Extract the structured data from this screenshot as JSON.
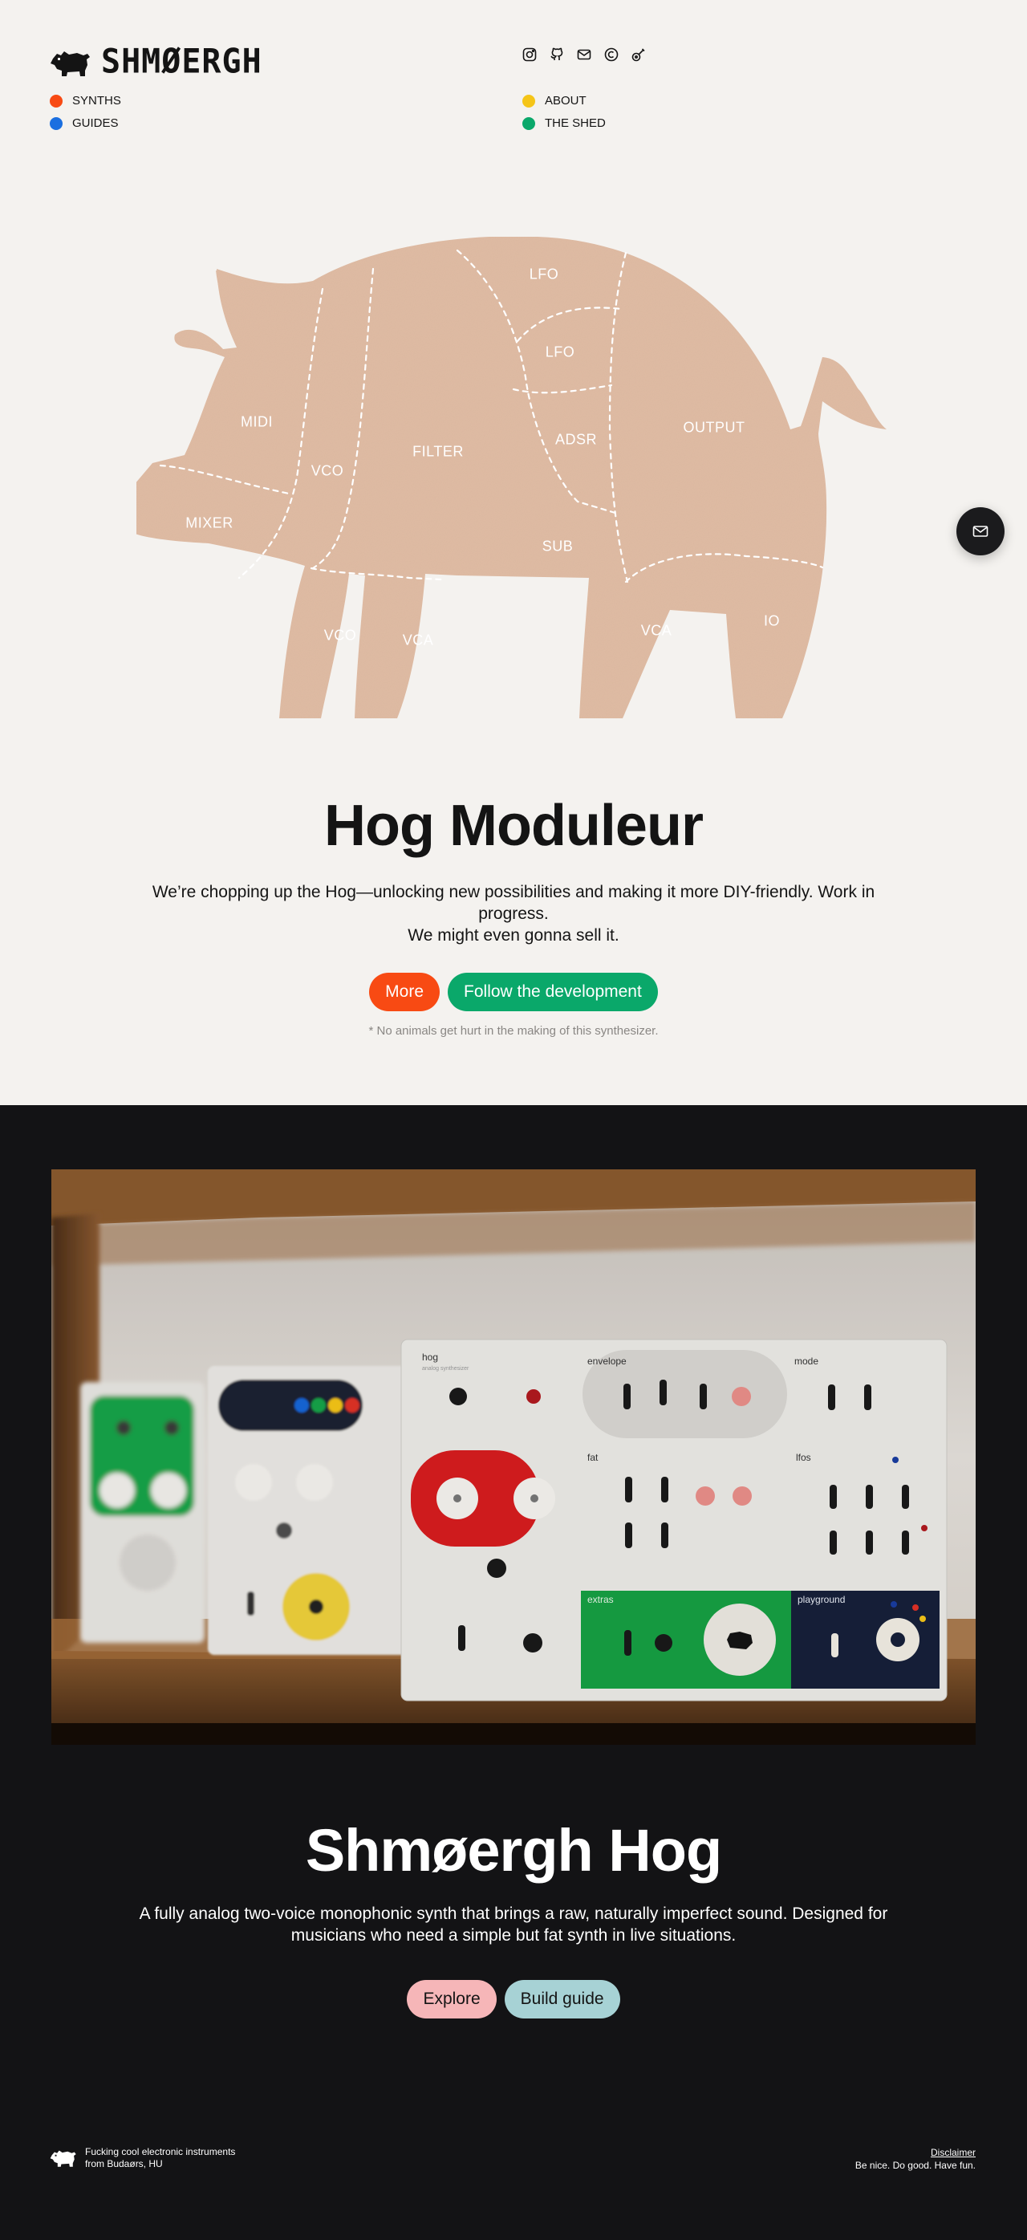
{
  "brand": {
    "wordmark": "SHMØERGH"
  },
  "nav": {
    "left": [
      {
        "label": "SYNTHS",
        "color": "#f84a13"
      },
      {
        "label": "GUIDES",
        "color": "#1b6fe0"
      }
    ],
    "right": [
      {
        "label": "ABOUT",
        "color": "#f5c518"
      },
      {
        "label": "THE SHED",
        "color": "#0aa86a"
      }
    ]
  },
  "social": [
    "instagram-icon",
    "github-icon",
    "mail-icon",
    "copyright-icon",
    "guitar-icon"
  ],
  "pig_sections": {
    "lfo_top": "LFO",
    "lfo_mid": "LFO",
    "midi": "MIDI",
    "vco_body": "VCO",
    "filter": "FILTER",
    "adsr": "ADSR",
    "output": "OUTPUT",
    "mixer": "MIXER",
    "sub": "SUB",
    "vco_leg": "VCO",
    "vca_front": "VCA",
    "vca_back": "VCA",
    "io": "IO"
  },
  "hero": {
    "title": "Hog Moduleur",
    "desc_line1": "We’re chopping up the Hog—unlocking new possibilities and making it more DIY-friendly. Work in progress.",
    "desc_line2": "We might even gonna sell it.",
    "btn_more": "More",
    "btn_follow": "Follow the development",
    "footnote": "* No animals get hurt in the making of this synthesizer."
  },
  "product": {
    "title": "Shmøergh Hog",
    "desc": "A fully analog two-voice monophonic synth that brings a raw, naturally imperfect sound. Designed for musicians who need a simple but fat synth in live situations.",
    "btn_explore": "Explore",
    "btn_build": "Build guide"
  },
  "panel": {
    "name": "hog",
    "subtitle": "analog synthesizer",
    "envelope": "envelope",
    "mode": "mode",
    "fat": "fat",
    "lfos": "lfos",
    "extras": "extras",
    "playground": "playground"
  },
  "footer": {
    "tagline": "Fucking cool electronic instruments from Budaørs, HU",
    "disclaimer": "Disclaimer",
    "motto": "Be nice. Do good. Have fun."
  }
}
